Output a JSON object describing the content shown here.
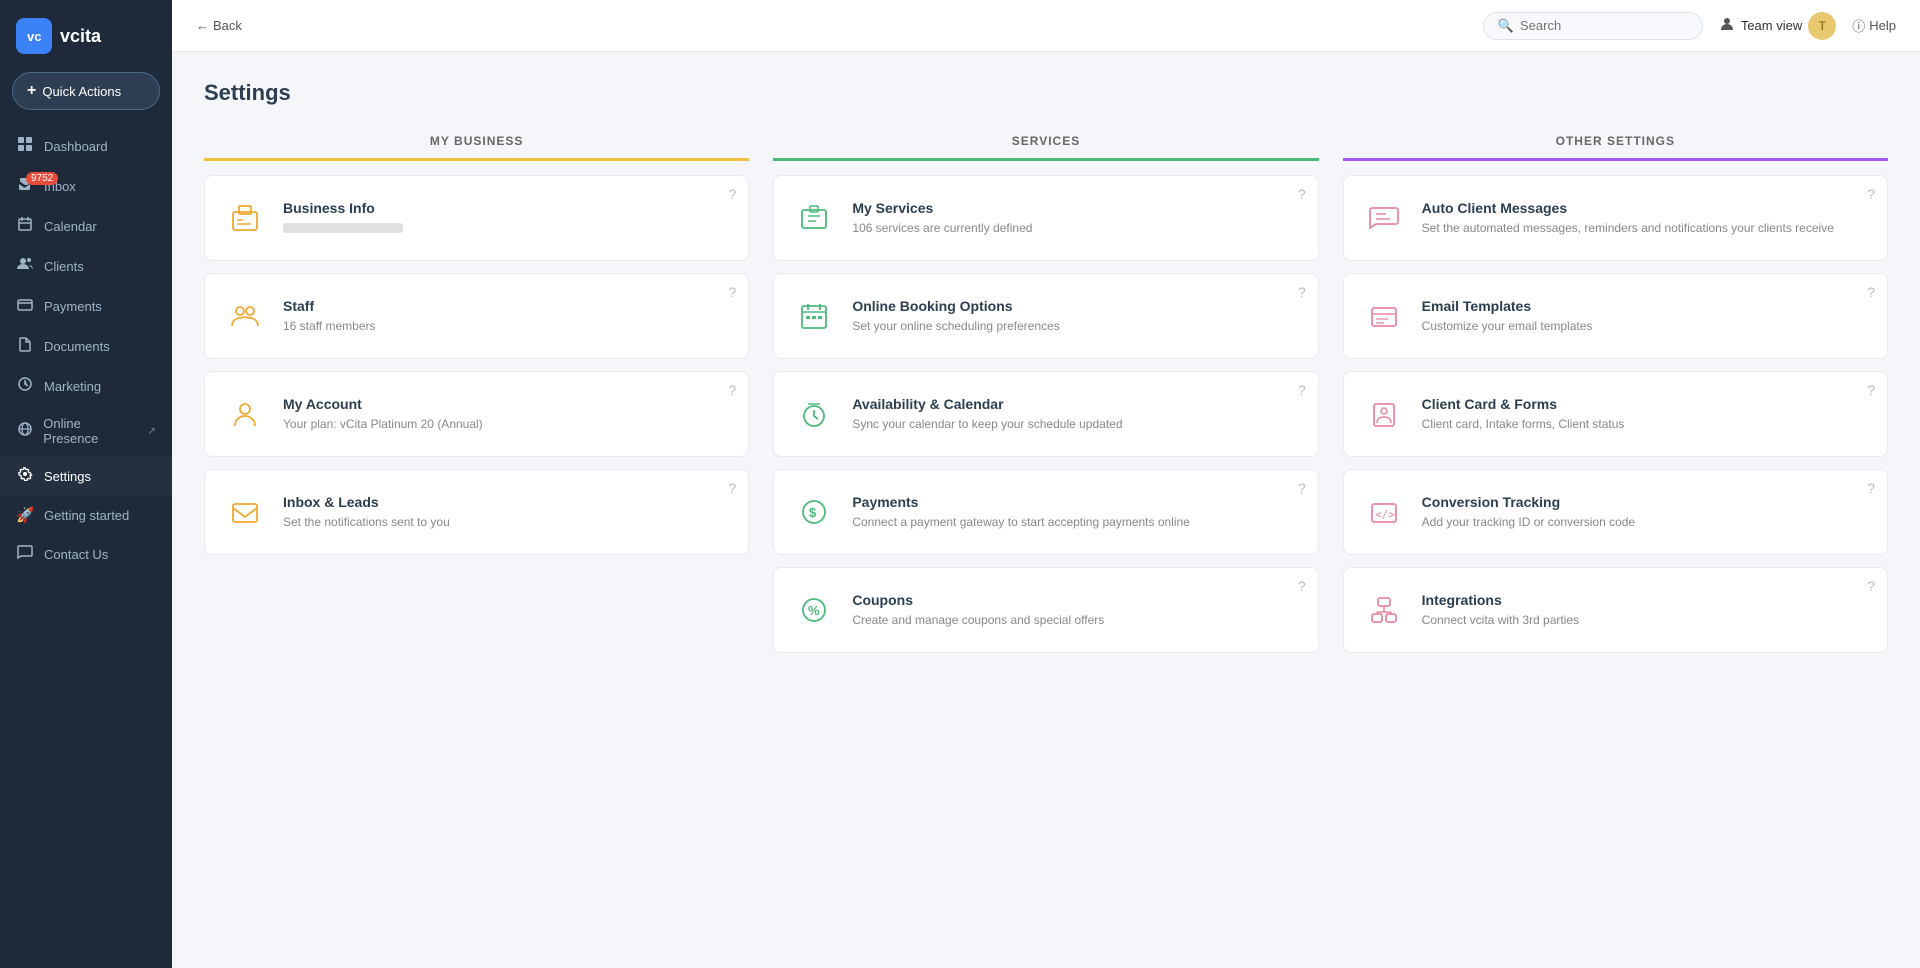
{
  "logo": {
    "icon": "vc",
    "text": "vcita"
  },
  "quick_actions": {
    "label": "Quick Actions"
  },
  "sidebar": {
    "items": [
      {
        "id": "dashboard",
        "label": "Dashboard",
        "icon": "⊞",
        "active": false,
        "badge": null
      },
      {
        "id": "inbox",
        "label": "Inbox",
        "icon": "✉",
        "active": false,
        "badge": "9752"
      },
      {
        "id": "calendar",
        "label": "Calendar",
        "icon": "📅",
        "active": false,
        "badge": null
      },
      {
        "id": "clients",
        "label": "Clients",
        "icon": "👥",
        "active": false,
        "badge": null
      },
      {
        "id": "payments",
        "label": "Payments",
        "icon": "💳",
        "active": false,
        "badge": null
      },
      {
        "id": "documents",
        "label": "Documents",
        "icon": "📄",
        "active": false,
        "badge": null
      },
      {
        "id": "marketing",
        "label": "Marketing",
        "icon": "🎯",
        "active": false,
        "badge": null
      },
      {
        "id": "online-presence",
        "label": "Online Presence",
        "icon": "🌐",
        "active": false,
        "badge": null,
        "external": true
      },
      {
        "id": "settings",
        "label": "Settings",
        "icon": "⚙",
        "active": true,
        "badge": null
      },
      {
        "id": "getting-started",
        "label": "Getting started",
        "icon": "🚀",
        "active": false,
        "badge": null
      },
      {
        "id": "contact-us",
        "label": "Contact Us",
        "icon": "✉",
        "active": false,
        "badge": null
      }
    ]
  },
  "topbar": {
    "back_label": "Back",
    "search_placeholder": "Search",
    "team_view_label": "Team view",
    "help_label": "Help"
  },
  "page": {
    "title": "Settings"
  },
  "sections": {
    "my_business": {
      "header": "MY BUSINESS",
      "cards": [
        {
          "id": "business-info",
          "title": "Business Info",
          "desc_blurred": true,
          "desc": ""
        },
        {
          "id": "staff",
          "title": "Staff",
          "desc": "16 staff members"
        },
        {
          "id": "my-account",
          "title": "My Account",
          "desc": "Your plan: vCita Platinum 20 (Annual)"
        },
        {
          "id": "inbox-leads",
          "title": "Inbox & Leads",
          "desc": "Set the notifications sent to you"
        }
      ]
    },
    "services": {
      "header": "SERVICES",
      "cards": [
        {
          "id": "my-services",
          "title": "My Services",
          "desc": "106 services are currently defined"
        },
        {
          "id": "online-booking",
          "title": "Online Booking Options",
          "desc": "Set your online scheduling preferences"
        },
        {
          "id": "availability-calendar",
          "title": "Availability & Calendar",
          "desc": "Sync your calendar to keep your schedule updated"
        },
        {
          "id": "payments",
          "title": "Payments",
          "desc": "Connect a payment gateway to start accepting payments online"
        },
        {
          "id": "coupons",
          "title": "Coupons",
          "desc": "Create and manage coupons and special offers"
        }
      ]
    },
    "other_settings": {
      "header": "OTHER SETTINGS",
      "cards": [
        {
          "id": "auto-client-messages",
          "title": "Auto Client Messages",
          "desc": "Set the automated messages, reminders and notifications your clients receive"
        },
        {
          "id": "email-templates",
          "title": "Email Templates",
          "desc": "Customize your email templates"
        },
        {
          "id": "client-card-forms",
          "title": "Client Card & Forms",
          "desc": "Client card, Intake forms, Client status"
        },
        {
          "id": "conversion-tracking",
          "title": "Conversion Tracking",
          "desc": "Add your tracking ID or conversion code"
        },
        {
          "id": "integrations",
          "title": "Integrations",
          "desc": "Connect vcita with 3rd parties"
        }
      ]
    }
  }
}
